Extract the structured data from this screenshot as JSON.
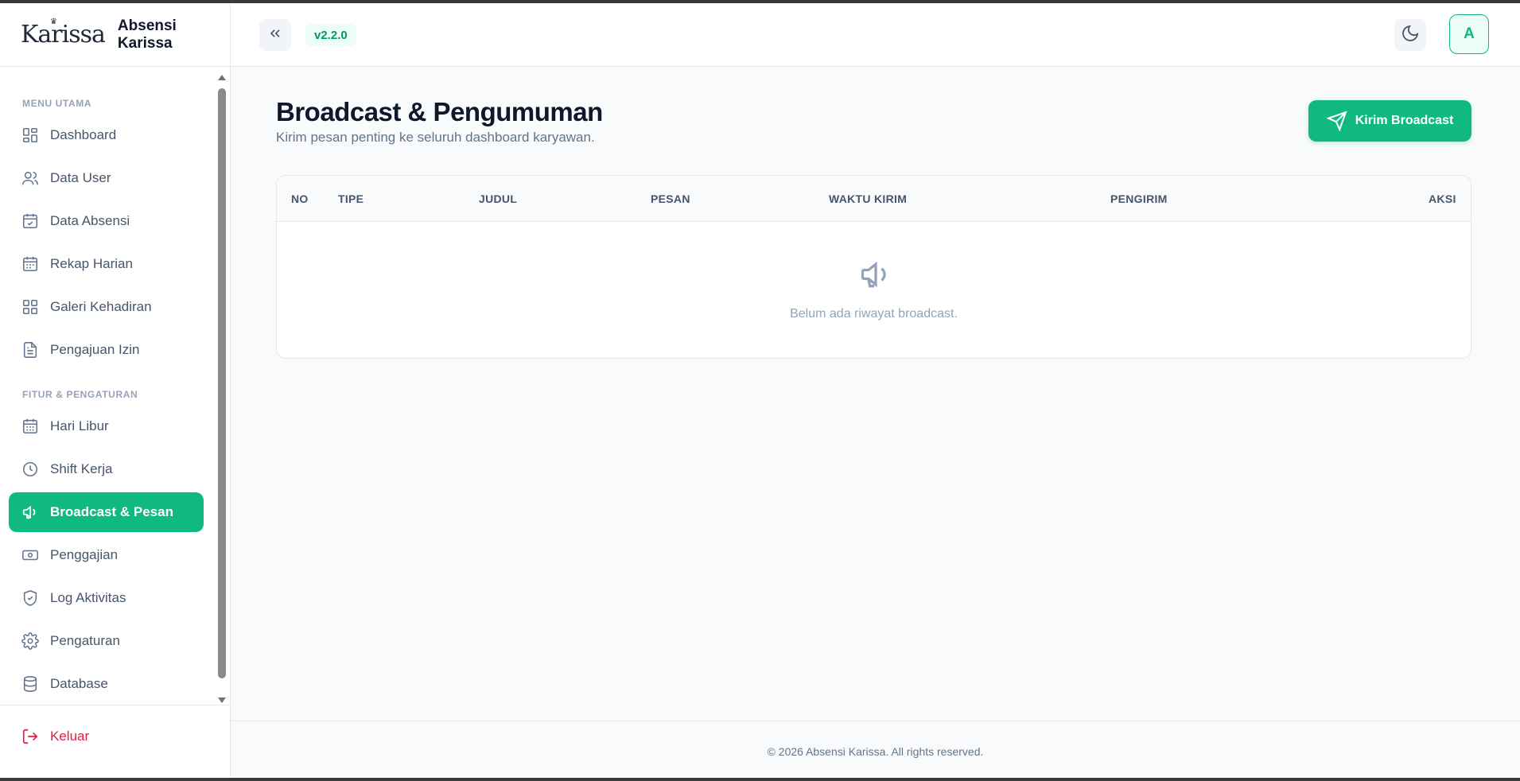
{
  "brand": {
    "logo_text": "Karissa",
    "name": "Absensi Karissa"
  },
  "header": {
    "version": "v2.2.0",
    "avatar_initial": "A"
  },
  "sidebar": {
    "section_main": "MENU UTAMA",
    "section_features": "FITUR & PENGATURAN",
    "items": [
      {
        "label": "Dashboard",
        "icon": "grid-icon"
      },
      {
        "label": "Data User",
        "icon": "users-icon"
      },
      {
        "label": "Data Absensi",
        "icon": "calendar-check-icon"
      },
      {
        "label": "Rekap Harian",
        "icon": "calendar-icon"
      },
      {
        "label": "Galeri Kehadiran",
        "icon": "grid-icon"
      },
      {
        "label": "Pengajuan Izin",
        "icon": "document-icon"
      },
      {
        "label": "Hari Libur",
        "icon": "calendar-icon"
      },
      {
        "label": "Shift Kerja",
        "icon": "clock-icon"
      },
      {
        "label": "Broadcast & Pesan",
        "icon": "megaphone-icon",
        "active": true
      },
      {
        "label": "Penggajian",
        "icon": "banknote-icon"
      },
      {
        "label": "Log Aktivitas",
        "icon": "shield-check-icon"
      },
      {
        "label": "Pengaturan",
        "icon": "gear-icon"
      },
      {
        "label": "Database",
        "icon": "database-icon"
      }
    ],
    "logout": "Keluar"
  },
  "main": {
    "title": "Broadcast & Pengumuman",
    "subtitle": "Kirim pesan penting ke seluruh dashboard karyawan.",
    "send_button": "Kirim Broadcast",
    "table": {
      "headers": [
        "NO",
        "TIPE",
        "JUDUL",
        "PESAN",
        "WAKTU KIRIM",
        "PENGIRIM",
        "AKSI"
      ],
      "empty_text": "Belum ada riwayat broadcast."
    }
  },
  "footer": {
    "text": "© 2026 Absensi Karissa. All rights reserved."
  },
  "colors": {
    "accent": "#10b981",
    "danger": "#e11d48"
  }
}
